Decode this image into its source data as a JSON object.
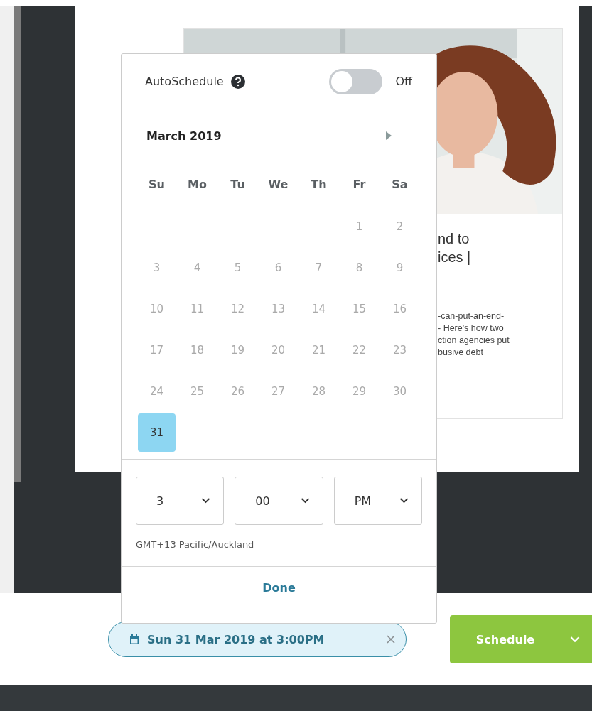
{
  "article_card": {
    "title_lines": [
      "nd to",
      "ices |"
    ],
    "description_lines": [
      "-can-put-an-end-",
      "- Here's how two",
      "ction agencies put",
      "busive debt"
    ]
  },
  "schedule_popover": {
    "autoschedule": {
      "label": "AutoSchedule",
      "on": false,
      "state_label": "Off"
    },
    "calendar": {
      "month": "March 2019",
      "weekdays": [
        "Su",
        "Mo",
        "Tu",
        "We",
        "Th",
        "Fr",
        "Sa"
      ],
      "weeks": [
        [
          {
            "day": "1",
            "selected": false
          },
          {
            "day": "2",
            "selected": false
          }
        ],
        [
          {
            "day": "3",
            "selected": false
          },
          {
            "day": "4",
            "selected": false
          },
          {
            "day": "5",
            "selected": false
          },
          {
            "day": "6",
            "selected": false
          },
          {
            "day": "7",
            "selected": false
          },
          {
            "day": "8",
            "selected": false
          },
          {
            "day": "9",
            "selected": false
          }
        ],
        [
          {
            "day": "10",
            "selected": false
          },
          {
            "day": "11",
            "selected": false
          },
          {
            "day": "12",
            "selected": false
          },
          {
            "day": "13",
            "selected": false
          },
          {
            "day": "14",
            "selected": false
          },
          {
            "day": "15",
            "selected": false
          },
          {
            "day": "16",
            "selected": false
          }
        ],
        [
          {
            "day": "17",
            "selected": false
          },
          {
            "day": "18",
            "selected": false
          },
          {
            "day": "19",
            "selected": false
          },
          {
            "day": "20",
            "selected": false
          },
          {
            "day": "21",
            "selected": false
          },
          {
            "day": "22",
            "selected": false
          },
          {
            "day": "23",
            "selected": false
          }
        ],
        [
          {
            "day": "24",
            "selected": false
          },
          {
            "day": "25",
            "selected": false
          },
          {
            "day": "26",
            "selected": false
          },
          {
            "day": "27",
            "selected": false
          },
          {
            "day": "28",
            "selected": false
          },
          {
            "day": "29",
            "selected": false
          },
          {
            "day": "30",
            "selected": false
          }
        ],
        [
          {
            "day": "31",
            "selected": true
          }
        ]
      ]
    },
    "time": {
      "hour": "3",
      "minute": "00",
      "period": "PM"
    },
    "timezone": "GMT+13 Pacific/Auckland",
    "done_label": "Done"
  },
  "scheduled_chip": {
    "text": "Sun 31 Mar 2019 at 3:00PM"
  },
  "schedule_button": {
    "label": "Schedule"
  }
}
